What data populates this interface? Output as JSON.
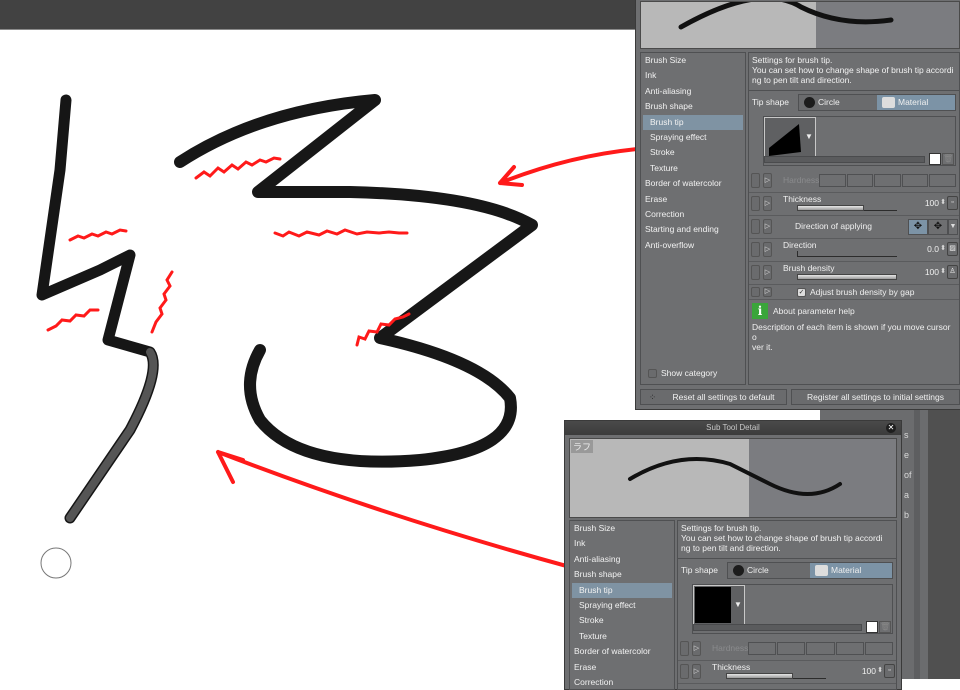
{
  "canvas": {
    "annotation_color": "#ff1a1a",
    "stroke_color": "#151515",
    "brush_cursor": "circle"
  },
  "dialog": {
    "title": "Sub Tool Detail",
    "preset_label": "ラフ",
    "categories": [
      {
        "label": "Brush Size",
        "sub": false
      },
      {
        "label": "Ink",
        "sub": false
      },
      {
        "label": "Anti-aliasing",
        "sub": false
      },
      {
        "label": "Brush shape",
        "sub": false
      },
      {
        "label": "Brush tip",
        "sub": true,
        "selected": true
      },
      {
        "label": "Spraying effect",
        "sub": true
      },
      {
        "label": "Stroke",
        "sub": true
      },
      {
        "label": "Texture",
        "sub": true
      },
      {
        "label": "Border of watercolor",
        "sub": false
      },
      {
        "label": "Erase",
        "sub": false
      },
      {
        "label": "Correction",
        "sub": false
      },
      {
        "label": "Starting and ending",
        "sub": false
      },
      {
        "label": "Anti-overflow",
        "sub": false
      }
    ],
    "description": "Settings for brush tip.\nYou can set how to change shape of brush tip according to pen tilt and direction.",
    "desc_line1": "Settings for brush tip.",
    "desc_line2": "You can set how to change shape of brush tip accordi",
    "desc_line3": "ng to pen tilt and direction.",
    "tip_shape_label": "Tip shape",
    "tip_shape_options": [
      "Circle",
      "Material"
    ],
    "tip_shape_selected": "Material",
    "params": {
      "hardness": {
        "label": "Hardness",
        "enabled": false
      },
      "thickness": {
        "label": "Thickness",
        "value": "100",
        "fill": 0.67
      },
      "direction_of_applying": {
        "label": "Direction of applying",
        "selected": "horizontal"
      },
      "direction": {
        "label": "Direction",
        "value": "0.0",
        "fill": 0.0
      },
      "brush_density": {
        "label": "Brush density",
        "value": "100",
        "fill": 1.0
      },
      "adjust_density": {
        "label": "Adjust brush density by gap",
        "checked": true
      }
    },
    "help": {
      "title": "About parameter help",
      "text": "Description of each item is shown if you move cursor over it.",
      "line1": "Description of each item is shown if you move cursor o",
      "line2": "ver it."
    },
    "show_category": "Show category",
    "reset_label": "Reset all settings to default",
    "register_label": "Register all settings to initial settings",
    "colors": {
      "panel": "#6e6f71",
      "selected": "#7c93a6",
      "info_icon": "#3aa53a"
    }
  },
  "background_panel": {
    "chars": [
      "s",
      "e",
      "of",
      "a",
      "b"
    ]
  }
}
